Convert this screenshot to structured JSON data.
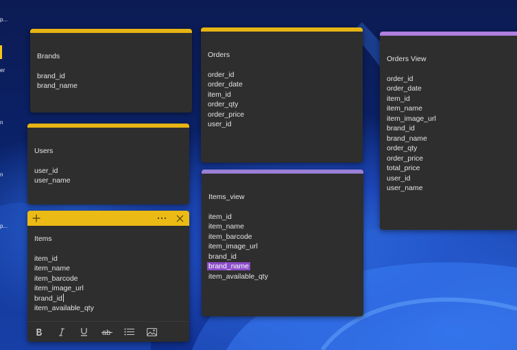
{
  "desktop": {
    "labels": [
      "p...",
      "er",
      "n",
      "p..."
    ]
  },
  "notes": {
    "brands": {
      "title": "Brands",
      "fields": [
        "brand_id",
        "brand_name"
      ],
      "accent": "#e6b414"
    },
    "users": {
      "title": "Users",
      "fields": [
        "user_id",
        "user_name"
      ],
      "accent": "#e6b414"
    },
    "items": {
      "title": "Items",
      "fields": [
        "item_id",
        "item_name",
        "item_barcode",
        "item_image_url",
        "brand_id",
        "item_available_qty"
      ],
      "accent": "#ebba14",
      "toolbar": [
        "bold-icon",
        "italic-icon",
        "underline-icon",
        "strikethrough-icon",
        "bullet-list-icon",
        "image-icon"
      ]
    },
    "orders": {
      "title": "Orders",
      "fields": [
        "order_id",
        "order_date",
        "item_id",
        "order_qty",
        "order_price",
        "user_id"
      ],
      "accent": "#e6b414"
    },
    "items_view": {
      "title": "Items_view",
      "fields": [
        "item_id",
        "item_name",
        "item_barcode",
        "item_image_url",
        "brand_id",
        "brand_name",
        "item_available_qty"
      ],
      "accent": "#9a7fd6",
      "highlighted_field": "brand_name"
    },
    "orders_view": {
      "title": "Orders View",
      "fields": [
        "order_id",
        "order_date",
        "item_id",
        "item_name",
        "item_image_url",
        "brand_id",
        "brand_name",
        "order_qty",
        "order_price",
        "total_price",
        "user_id",
        "user_name"
      ],
      "accent": "#b07fe0"
    }
  }
}
